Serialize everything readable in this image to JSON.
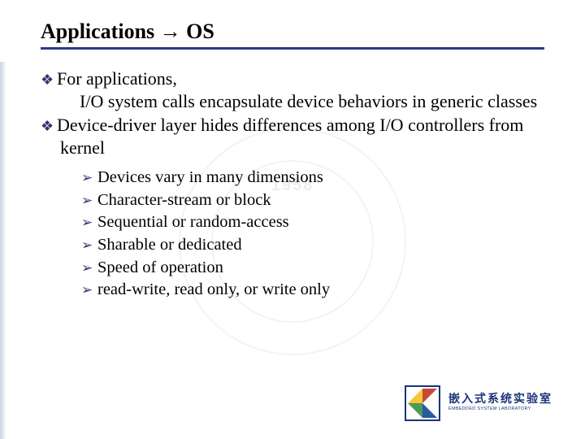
{
  "title": "Applications → OS",
  "watermark_year": "1958",
  "bullets": [
    {
      "lead": "For applications,",
      "rest": "I/O system calls encapsulate device behaviors in generic classes"
    },
    {
      "lead": "Device-driver layer hides differences among I/O controllers from kernel",
      "rest": ""
    }
  ],
  "sub_bullets": [
    "Devices vary in many dimensions",
    "Character-stream or block",
    "Sequential or random-access",
    "Sharable or dedicated",
    "Speed of operation",
    "read-write, read only, or write only"
  ],
  "footer": {
    "cn": "嵌入式系统实验室",
    "en": "EMBEDDED SYSTEM LABORATORY"
  }
}
